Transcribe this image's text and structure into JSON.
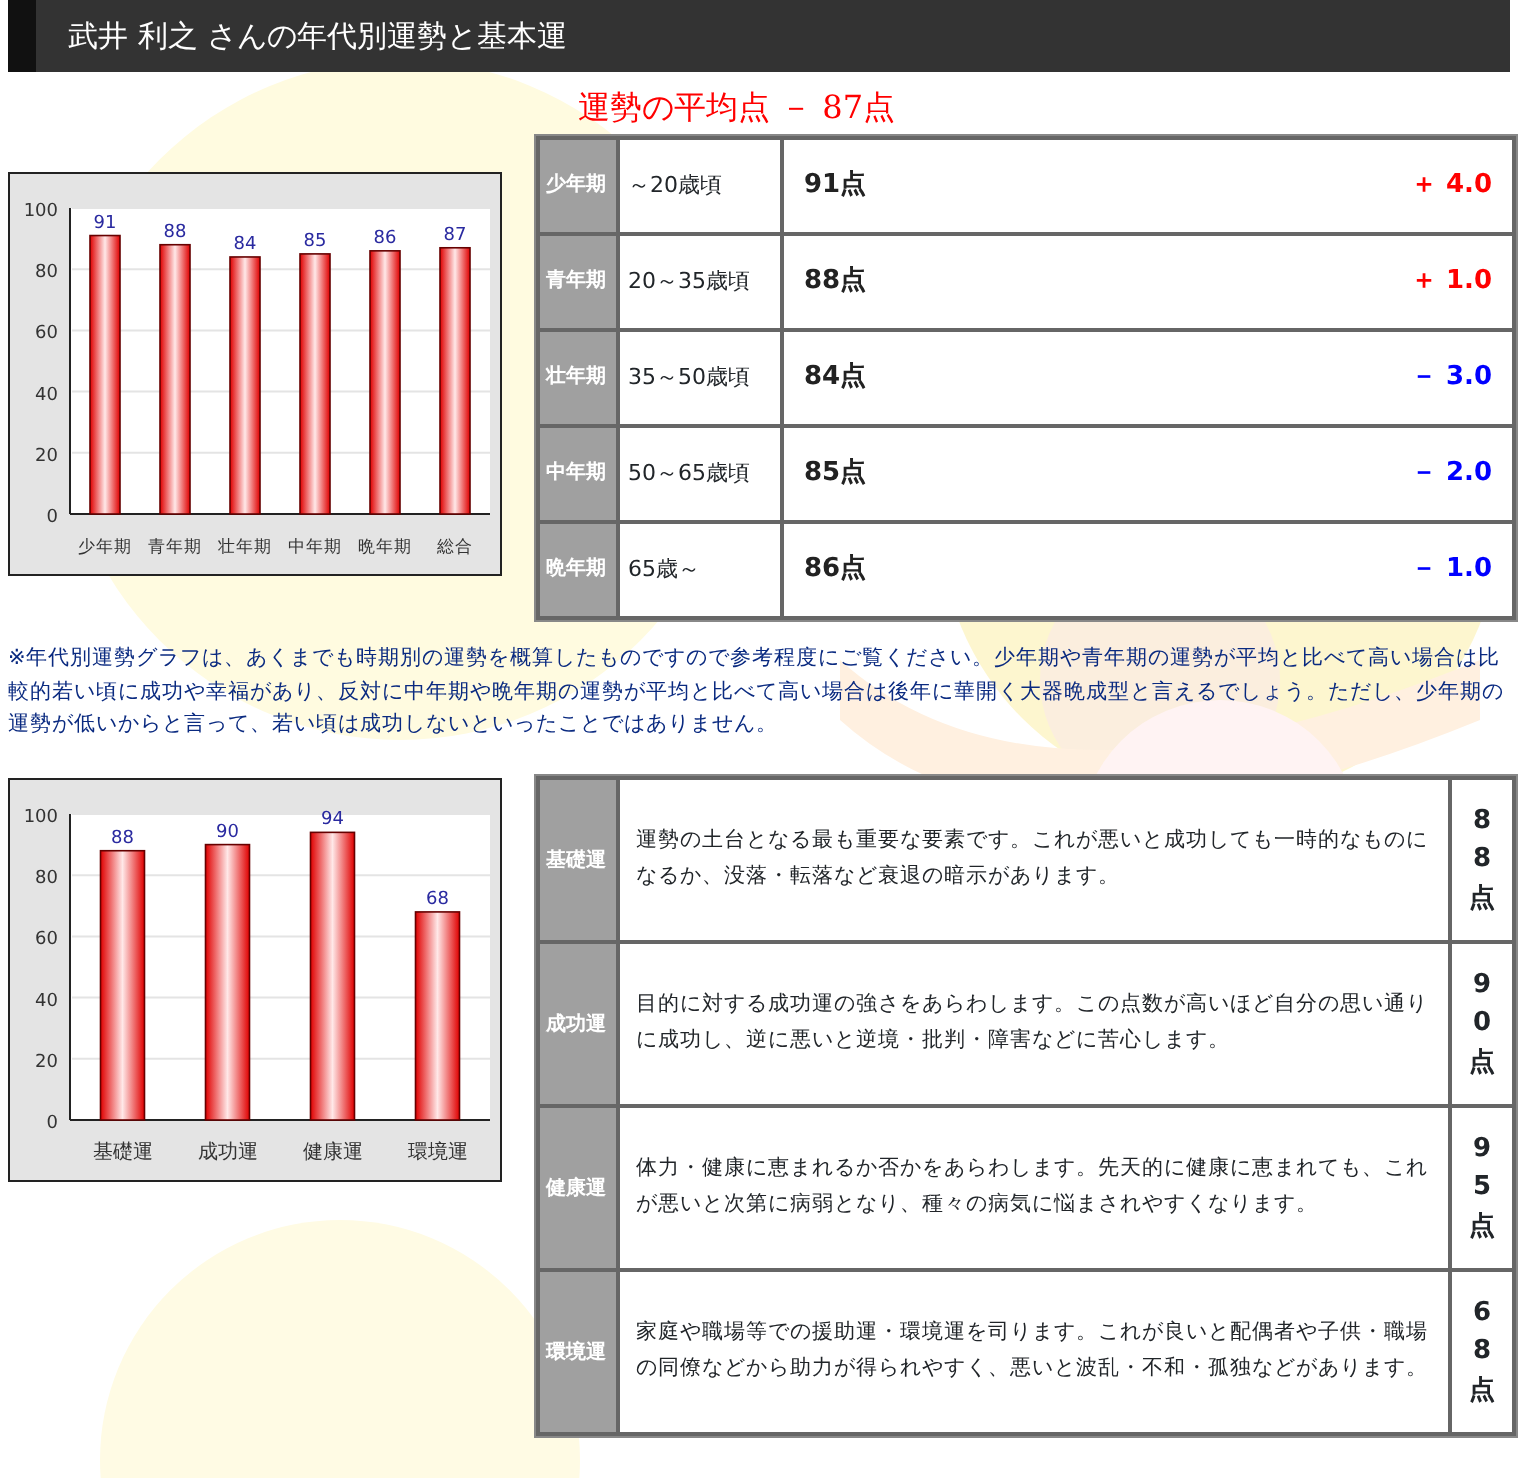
{
  "header": {
    "title": "武井 利之 さんの年代別運勢と基本運"
  },
  "average": {
    "title": "運勢の平均点 － 87点"
  },
  "age_chart": {
    "chart_data": {
      "type": "bar",
      "categories": [
        "少年期",
        "青年期",
        "壮年期",
        "中年期",
        "晩年期",
        "総合"
      ],
      "values": [
        91,
        88,
        84,
        85,
        86,
        87
      ],
      "ylim": [
        0,
        100
      ],
      "yticks": [
        0,
        20,
        40,
        60,
        80,
        100
      ],
      "data_labels": true,
      "grid": true
    }
  },
  "age_table": [
    {
      "period": "少年期",
      "ages": "～20歳頃",
      "score": "91点",
      "diff": "＋ 4.0",
      "color": "#ff0000"
    },
    {
      "period": "青年期",
      "ages": "20～35歳頃",
      "score": "88点",
      "diff": "＋ 1.0",
      "color": "#ff0000"
    },
    {
      "period": "壮年期",
      "ages": "35～50歳頃",
      "score": "84点",
      "diff": "－ 3.0",
      "color": "#0000ff"
    },
    {
      "period": "中年期",
      "ages": "50～65歳頃",
      "score": "85点",
      "diff": "－ 2.0",
      "color": "#0000ff"
    },
    {
      "period": "晩年期",
      "ages": "65歳～",
      "score": "86点",
      "diff": "－ 1.0",
      "color": "#0000ff"
    }
  ],
  "note": "※年代別運勢グラフは、あくまでも時期別の運勢を概算したものですので参考程度にご覧ください。少年期や青年期の運勢が平均と比べて高い場合は比較的若い頃に成功や幸福があり、反対に中年期や晩年期の運勢が平均と比べて高い場合は後年に華開く大器晩成型と言えるでしょう。ただし、少年期の運勢が低いからと言って、若い頃は成功しないといったことではありません。",
  "luck_chart": {
    "chart_data": {
      "type": "bar",
      "categories": [
        "基礎運",
        "成功運",
        "健康運",
        "環境運"
      ],
      "values": [
        88,
        90,
        94,
        68
      ],
      "ylim": [
        0,
        100
      ],
      "yticks": [
        0,
        20,
        40,
        60,
        80,
        100
      ],
      "data_labels": true,
      "grid": true
    }
  },
  "luck_table": [
    {
      "name": "基礎運",
      "description": "運勢の土台となる最も重要な要素です。これが悪いと成功しても一時的なものになるか、没落・転落など衰退の暗示があります。",
      "score": "88点"
    },
    {
      "name": "成功運",
      "description": "目的に対する成功運の強さをあらわします。この点数が高いほど自分の思い通りに成功し、逆に悪いと逆境・批判・障害などに苦心します。",
      "score": "90点"
    },
    {
      "name": "健康運",
      "description": "体力・健康に恵まれるか否かをあらわします。先天的に健康に恵まれても、これが悪いと次第に病弱となり、種々の病気に悩まされやすくなります。",
      "score": "95点"
    },
    {
      "name": "環境運",
      "description": "家庭や職場等での援助運・環境運を司ります。これが良いと配偶者や子供・職場の同僚などから助力が得られやすく、悪いと波乱・不和・孤独などがあります。",
      "score": "68点"
    }
  ]
}
